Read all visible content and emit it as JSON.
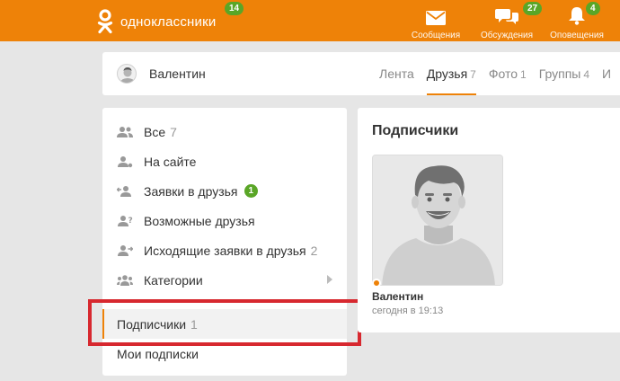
{
  "header": {
    "logo_text": "одноклассники",
    "logo_badge": "14",
    "nav": [
      {
        "label": "Сообщения",
        "badge": "",
        "icon": "envelope-icon"
      },
      {
        "label": "Обсуждения",
        "badge": "27",
        "icon": "chat-bubbles-icon"
      },
      {
        "label": "Оповещения",
        "badge": "4",
        "icon": "bell-icon"
      }
    ],
    "colors": {
      "brand": "#ee8208",
      "badge": "#5aa627"
    }
  },
  "profile": {
    "name": "Валентин",
    "tabs": [
      {
        "label": "Лента",
        "count": ""
      },
      {
        "label": "Друзья",
        "count": "7"
      },
      {
        "label": "Фото",
        "count": "1"
      },
      {
        "label": "Группы",
        "count": "4"
      },
      {
        "label": "И",
        "count": ""
      }
    ]
  },
  "menu": {
    "items": [
      {
        "label": "Все",
        "count": "7",
        "icon": "users-icon"
      },
      {
        "label": "На сайте",
        "count": "",
        "icon": "user-online-icon"
      },
      {
        "label": "Заявки в друзья",
        "badge": "1",
        "icon": "user-incoming-icon"
      },
      {
        "label": "Возможные друзья",
        "count": "",
        "icon": "user-question-icon"
      },
      {
        "label": "Исходящие заявки в друзья",
        "count": "2",
        "icon": "user-outgoing-icon"
      },
      {
        "label": "Категории",
        "count": "",
        "icon": "users-group-icon"
      },
      {
        "label": "Подписчики",
        "count": "1"
      },
      {
        "label": "Мои подписки",
        "count": ""
      }
    ],
    "highlight_color": "#d7282f"
  },
  "panel": {
    "title": "Подписчики",
    "card": {
      "name": "Валентин",
      "time": "сегодня в 19:13"
    }
  }
}
